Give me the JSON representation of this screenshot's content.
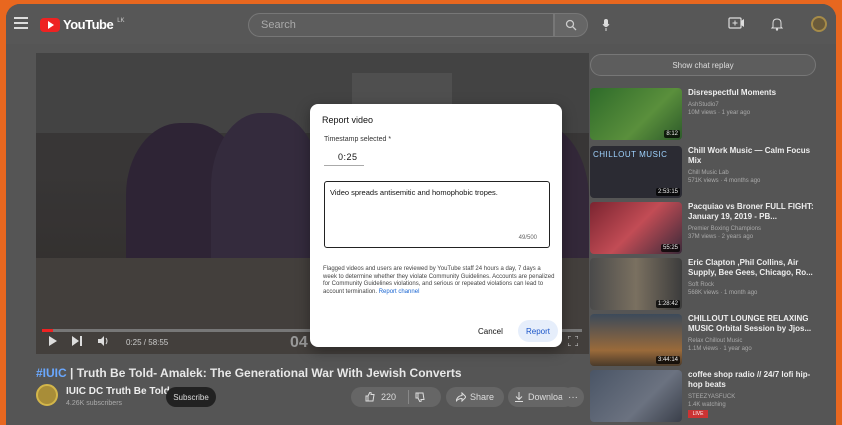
{
  "topbar": {
    "logo_text": "YouTube",
    "logo_sup": "LK",
    "search_placeholder": "Search"
  },
  "player": {
    "time": "0:25 / 58:55",
    "overlay_text": "04",
    "progress_fraction": 0.007
  },
  "video": {
    "hashtag": "#IUIC",
    "title_rest": " | Truth Be Told- Amalek: The Generational War With Jewish Converts",
    "channel_name": "IUIC DC Truth Be Told",
    "subscribers": "4.26K subscribers",
    "subscribe_label": "Subscribe",
    "likes": "220",
    "share_label": "Share",
    "download_label": "Download",
    "more_label": "···"
  },
  "sidebar": {
    "chat_replay_label": "Show chat replay",
    "items": [
      {
        "title": "Disrespectful Moments",
        "channel": "AshStudio7",
        "meta": "10M views · 1 year ago",
        "duration": "8:12"
      },
      {
        "title": "Chill Work Music — Calm Focus Mix",
        "channel": "Chill Music Lab",
        "meta": "571K views · 4 months ago",
        "duration": "2:53:15",
        "thumb_text": "CHILLOUT MUSIC"
      },
      {
        "title": "Pacquiao vs Broner FULL FIGHT: January 19, 2019 - PB...",
        "channel": "Premier Boxing Champions",
        "meta": "37M views · 2 years ago",
        "duration": "55:25"
      },
      {
        "title": "Eric Clapton ,Phil Collins, Air Supply, Bee Gees, Chicago, Ro...",
        "channel": "Soft Rock",
        "meta": "568K views · 1 month ago",
        "duration": "1:28:42"
      },
      {
        "title": "CHILLOUT LOUNGE RELAXING MUSIC Orbital Session by Jjos...",
        "channel": "Relax Chillout Music",
        "meta": "1.1M views · 1 year ago",
        "duration": "3:44:14"
      },
      {
        "title": "coffee shop radio // 24/7 lofi hip-hop beats",
        "channel": "STEEZYASFUCK",
        "meta": "1.4K watching",
        "live": "LIVE"
      }
    ]
  },
  "modal": {
    "title": "Report video",
    "timestamp_label": "Timestamp selected *",
    "timestamp_value": "0:25",
    "reason_text": "Video spreads antisemitic and homophobic tropes.",
    "counter": "49/500",
    "notice": "Flagged videos and users are reviewed by YouTube staff 24 hours a day, 7 days a week to determine whether they violate Community Guidelines. Accounts are penalized for Community Guidelines violations, and serious or repeated violations can lead to account termination.",
    "notice_link": "Report channel",
    "cancel_label": "Cancel",
    "report_label": "Report"
  }
}
